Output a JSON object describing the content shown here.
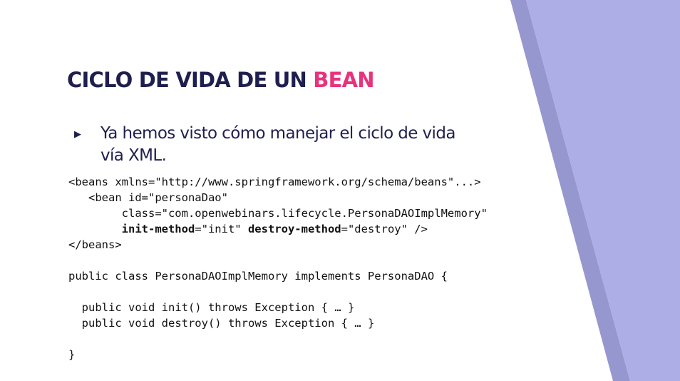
{
  "slide": {
    "title_main": "CICLO DE VIDA DE UN ",
    "title_accent": "BEAN",
    "bullet_text": "Ya hemos visto cómo manejar el ciclo de vida vía XML."
  },
  "code": {
    "beans_open": "<beans xmlns=\"http://www.springframework.org/schema/beans\"...>",
    "bean_open": "<bean id=\"personaDao\"",
    "bean_class": "class=\"com.openwebinars.lifecycle.PersonaDAOImplMemory\"",
    "init_attr": "init-method",
    "init_value": "=\"init\" ",
    "destroy_attr": "destroy-method",
    "destroy_value": "=\"destroy\" />",
    "beans_close": "</beans>",
    "class_decl": "public class PersonaDAOImplMemory implements PersonaDAO {",
    "init_decl": "public void init() throws Exception { … }",
    "destroy_decl": "public void destroy() throws Exception { … }",
    "class_close": "}"
  },
  "colors": {
    "title": "#1f1f4f",
    "accent": "#e8327c",
    "deco_light": "#aeaee6",
    "deco_dark": "#9797cf"
  }
}
